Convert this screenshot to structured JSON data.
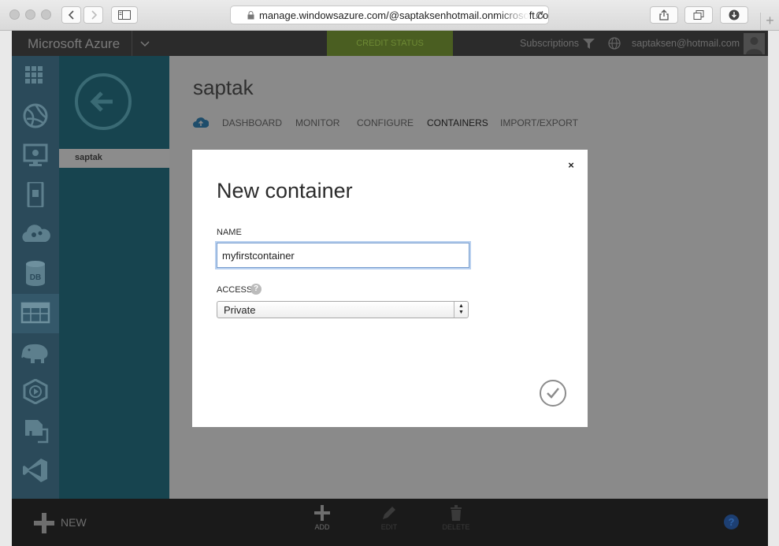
{
  "browser": {
    "url": "manage.windowsazure.com/@saptaksenhotmail.onmicrosoft.com",
    "new_tab_label": "+"
  },
  "topbar": {
    "app_title": "Microsoft Azure",
    "credit_status": "CREDIT STATUS",
    "subscriptions": "Subscriptions",
    "user_email": "saptaksen@hotmail.com"
  },
  "sidebar": {
    "nav_icons": [
      "all-items-icon",
      "web-apps-icon",
      "virtual-machines-icon",
      "mobile-services-icon",
      "cloud-services-icon",
      "sql-databases-icon",
      "storage-icon",
      "hdinsight-icon",
      "media-services-icon",
      "service-bus-icon",
      "visual-studio-icon"
    ],
    "active_index": 6
  },
  "panel": {
    "selected_item": "saptak"
  },
  "main": {
    "resource_name": "saptak",
    "tabs": [
      "DASHBOARD",
      "MONITOR",
      "CONFIGURE",
      "CONTAINERS",
      "IMPORT/EXPORT"
    ],
    "active_tab": "CONTAINERS"
  },
  "bottombar": {
    "new_label": "NEW",
    "add_label": "ADD",
    "edit_label": "EDIT",
    "delete_label": "DELETE",
    "help_label": "?"
  },
  "dialog": {
    "title": "New container",
    "close_label": "×",
    "name_label": "NAME",
    "name_value": "myfirstcontainer",
    "access_label": "ACCESS",
    "access_help": "?",
    "access_value": "Private"
  },
  "colors": {
    "azure_bar": "#2b2b2b",
    "sidebar": "#2b4a5a",
    "panel": "#17444f",
    "credit": "#4a5e21",
    "dialog_bg": "#ffffff"
  }
}
